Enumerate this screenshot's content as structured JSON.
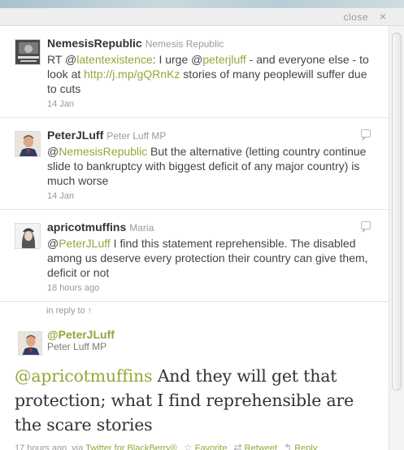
{
  "dialog": {
    "close_label": "close",
    "close_icon": "×"
  },
  "tweets": [
    {
      "screen_name": "NemesisRepublic",
      "full_name": "Nemesis Republic",
      "text_parts": [
        "RT @",
        "latentexistence",
        ": I urge @",
        "peterjluff",
        " - and everyone else - to look at ",
        "http://j.mp/gQRnKz",
        " stories of many peoplewill suffer due to cuts"
      ],
      "time": "14 Jan"
    },
    {
      "screen_name": "PeterJLuff",
      "full_name": "Peter Luff MP",
      "text_parts": [
        "@",
        "NemesisRepublic",
        " But the alternative (letting country continue slide to bankruptcy with biggest deficit of any major country) is much worse"
      ],
      "time": "14 Jan"
    },
    {
      "screen_name": "apricotmuffins",
      "full_name": "Maria",
      "text_parts": [
        "@",
        "PeterJLuff",
        " I find this statement reprehensible. The disabled among us deserve every protection their country can give them, deficit or not"
      ],
      "time": "18 hours ago"
    }
  ],
  "in_reply_to": "in reply to ↑",
  "main_tweet": {
    "screen_name": "@PeterJLuff",
    "full_name": "Peter Luff MP",
    "text_parts": [
      "@",
      "apricotmuffins",
      " And they will get that protection; what I find reprehensible are the scare stories"
    ],
    "time": "17 hours ago",
    "via_label": "via",
    "via_client": "Twitter for BlackBerry®",
    "favorite_label": "Favorite",
    "retweet_label": "Retweet",
    "reply_label": "Reply",
    "icons": [
      "star-icon",
      "retweet-icon",
      "reply-icon"
    ]
  },
  "colors": {
    "link": "#8fa938",
    "muted": "#999999",
    "text": "#333333"
  }
}
